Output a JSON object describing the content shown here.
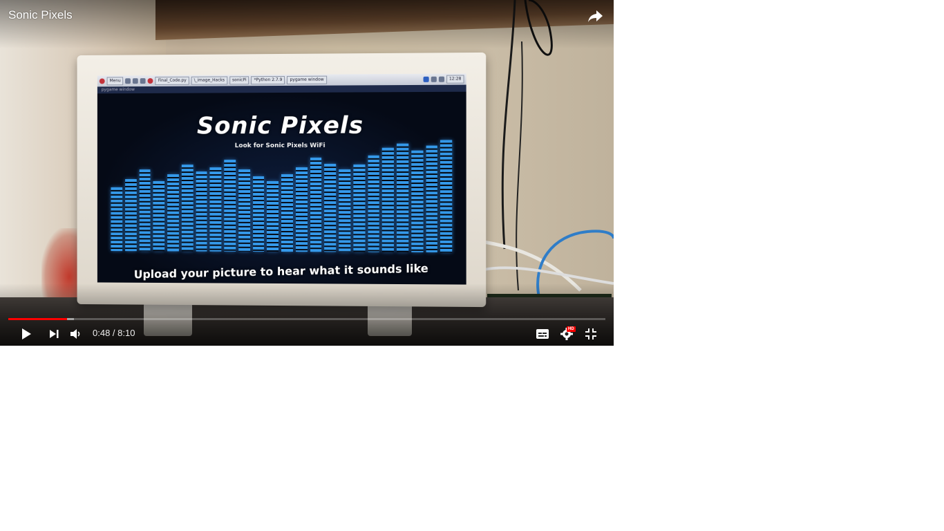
{
  "video": {
    "title": "Sonic Pixels",
    "current_time": "0:48",
    "separator": " / ",
    "duration": "8:10",
    "progress_played": 0.098,
    "progress_loaded": 0.11,
    "hd_label": "HD"
  },
  "screen_content": {
    "taskbar_items": [
      "Menu",
      "Final_Code.py",
      "\\_image_Hacks",
      "sonicPi",
      "*Python 2.7.9",
      "pygame window"
    ],
    "clock": "12:28",
    "window_title": "pygame window",
    "app_title": "Sonic Pixels",
    "app_subtitle": "Look for Sonic Pixels WiFi",
    "app_footer": "Upload your picture to hear what it sounds like"
  },
  "icons": {
    "share": "share-icon",
    "play": "play-icon",
    "next": "next-icon",
    "volume": "volume-icon",
    "captions": "captions-icon",
    "settings": "settings-gear-icon",
    "exit_fullscreen": "exit-fullscreen-icon"
  },
  "colors": {
    "progress_played": "#ff0000",
    "eq_blue": "#3aa8ff"
  }
}
